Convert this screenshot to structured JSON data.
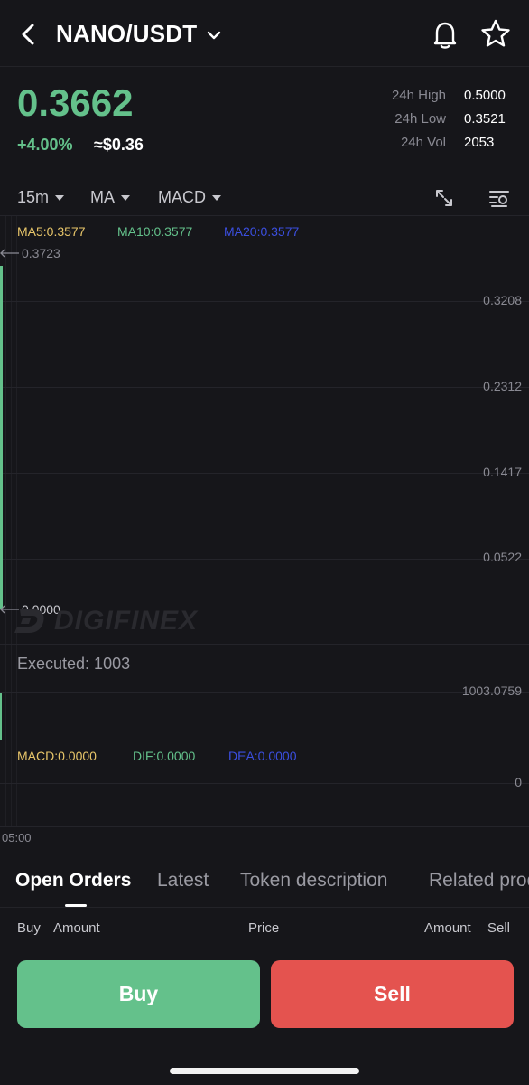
{
  "header": {
    "pair": "NANO/USDT",
    "icons": {
      "back": "chevron-left-icon",
      "dropdown": "chevron-down-icon",
      "alert": "bell-icon",
      "favorite": "star-icon"
    }
  },
  "summary": {
    "price": "0.3662",
    "change": "+4.00%",
    "approx": "≈$0.36",
    "stats": [
      {
        "label": "24h High",
        "value": "0.5000"
      },
      {
        "label": "24h Low",
        "value": "0.3521"
      },
      {
        "label": "24h Vol",
        "value": "2053"
      }
    ]
  },
  "toolbar": {
    "interval": "15m",
    "main_indicator": "MA",
    "sub_indicator": "MACD",
    "icons": {
      "fullscreen": "expand-icon",
      "settings": "chart-settings-icon"
    }
  },
  "chart": {
    "ma5": "MA5:0.3577",
    "ma10": "MA10:0.3577",
    "ma20": "MA20:0.3577",
    "max_marker": "0.3723",
    "min_marker": "0.0000",
    "price_axis": [
      "0.3208",
      "0.2312",
      "0.1417",
      "0.0522"
    ],
    "watermark": "DIGIFINEX",
    "executed": "Executed: 1003",
    "volume_axis": "1003.0759",
    "macd": "MACD:0.0000",
    "dif": "DIF:0.0000",
    "dea": "DEA:0.0000",
    "macd_axis": "0",
    "time_label": "05:00",
    "colors": {
      "ma5": "#e8c66a",
      "ma10": "#64c18b",
      "ma20": "#3b4fe0",
      "up": "#64c18b",
      "down": "#e4534f"
    }
  },
  "tabs": [
    {
      "label": "Open Orders",
      "active": true
    },
    {
      "label": "Latest",
      "active": false
    },
    {
      "label": "Token description",
      "active": false
    },
    {
      "label": "Related products",
      "active": false
    }
  ],
  "orders_header": {
    "buy": "Buy",
    "amount_left": "Amount",
    "price": "Price",
    "amount_right": "Amount",
    "sell": "Sell"
  },
  "actions": {
    "buy": "Buy",
    "sell": "Sell"
  }
}
